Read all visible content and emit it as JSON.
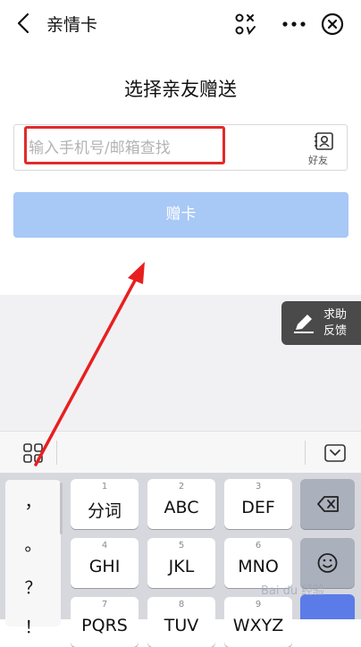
{
  "header": {
    "title": "亲情卡"
  },
  "page": {
    "heading": "选择亲友赠送"
  },
  "search": {
    "placeholder": "输入手机号/邮箱查找",
    "value": "",
    "friend_label": "好友"
  },
  "gift_button": {
    "label": "赠卡"
  },
  "help": {
    "line1": "求助",
    "line2": "反馈"
  },
  "keyboard": {
    "punctuation": [
      "，",
      "。",
      "？",
      "！"
    ],
    "rows": [
      [
        {
          "num": "1",
          "label": "分词"
        },
        {
          "num": "2",
          "label": "ABC"
        },
        {
          "num": "3",
          "label": "DEF"
        }
      ],
      [
        {
          "num": "4",
          "label": "GHI"
        },
        {
          "num": "5",
          "label": "JKL"
        },
        {
          "num": "6",
          "label": "MNO"
        }
      ],
      [
        {
          "num": "7",
          "label": "PQRS"
        },
        {
          "num": "8",
          "label": "TUV"
        },
        {
          "num": "9",
          "label": "WXYZ"
        }
      ]
    ]
  },
  "watermark": "Bai du 经验",
  "colors": {
    "accent": "#a8c8f6",
    "highlight": "#e02b2b",
    "help_bg": "#4a4a4a"
  }
}
